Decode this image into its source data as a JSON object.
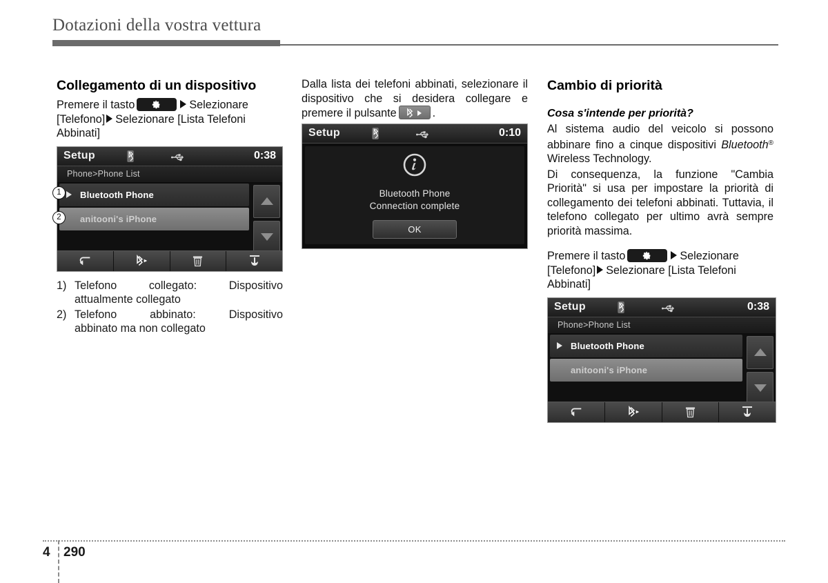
{
  "header": {
    "title": "Dotazioni della vostra vettura"
  },
  "footer": {
    "chapter": "4",
    "page": "290"
  },
  "col1": {
    "heading": "Collegamento di un dispositivo",
    "instruction_1": "Premere il tasto",
    "instruction_2": "Selezionare [Telefono]",
    "instruction_3": "Selezionare [Lista Telefoni Abbinati]",
    "setup_button_icon": "gear-icon",
    "screen": {
      "title": "Setup",
      "clock": "0:38",
      "breadcrumb": "Phone>Phone List",
      "rows": [
        {
          "label": "Bluetooth Phone",
          "state": "connected"
        },
        {
          "label": "anitooni's iPhone",
          "state": "paired"
        }
      ],
      "scroll_up_icon": "triangle-up-icon",
      "scroll_down_icon": "triangle-down-icon",
      "toolbar_icons": [
        "back-arrow-icon",
        "bluetooth-connect-icon",
        "trash-icon",
        "priority-icon"
      ],
      "status_icons": [
        "bluetooth-icon",
        "usb-icon"
      ]
    },
    "callouts": [
      "1",
      "2"
    ],
    "legend": [
      {
        "num": "1)",
        "term": "Telefono",
        "term2": "collegato:",
        "value": "Dispositivo",
        "desc": "attualmente collegato"
      },
      {
        "num": "2)",
        "term": "Telefono",
        "term2": "abbinato:",
        "value": "Dispositivo",
        "desc": "abbinato ma non collegato"
      }
    ]
  },
  "col2": {
    "paragraph_1": "Dalla lista dei telefoni abbinati, selezionare il dispositivo che si desidera collegare e premere il pulsante",
    "paragraph_1_end": ".",
    "bt_button_icon": "bluetooth-connect-icon",
    "screen": {
      "title": "Setup",
      "clock": "0:10",
      "info_icon": "info-icon",
      "message_line1": "Bluetooth Phone",
      "message_line2": "Connection complete",
      "ok_label": "OK",
      "status_icons": [
        "bluetooth-icon",
        "usb-icon"
      ]
    }
  },
  "col3": {
    "heading": "Cambio di priorità",
    "subheading": "Cosa s'intende per priorità?",
    "paragraph_1_a": "Al sistema audio del veicolo si possono abbinare fino a cinque dispositivi ",
    "paragraph_1_brand": "Bluetooth",
    "paragraph_1_reg": "®",
    "paragraph_1_b": " Wireless Technology.",
    "paragraph_2": "Di consequenza, la funzione \"Cambia Priorità\" si usa per impostare la priorità di collegamento dei telefoni abbinati. Tuttavia, il telefono collegato per ultimo avrà sempre priorità massima.",
    "instruction_1": "Premere il tasto",
    "instruction_2": "Selezionare [Telefono]",
    "instruction_3": "Selezionare [Lista Telefoni Abbinati]",
    "setup_button_icon": "gear-icon",
    "screen": {
      "title": "Setup",
      "clock": "0:38",
      "breadcrumb": "Phone>Phone List",
      "rows": [
        {
          "label": "Bluetooth Phone",
          "state": "connected"
        },
        {
          "label": "anitooni's iPhone",
          "state": "paired"
        }
      ],
      "scroll_up_icon": "triangle-up-icon",
      "scroll_down_icon": "triangle-down-icon",
      "toolbar_icons": [
        "back-arrow-icon",
        "bluetooth-connect-icon",
        "trash-icon",
        "priority-icon"
      ],
      "status_icons": [
        "bluetooth-icon",
        "usb-icon"
      ]
    }
  }
}
